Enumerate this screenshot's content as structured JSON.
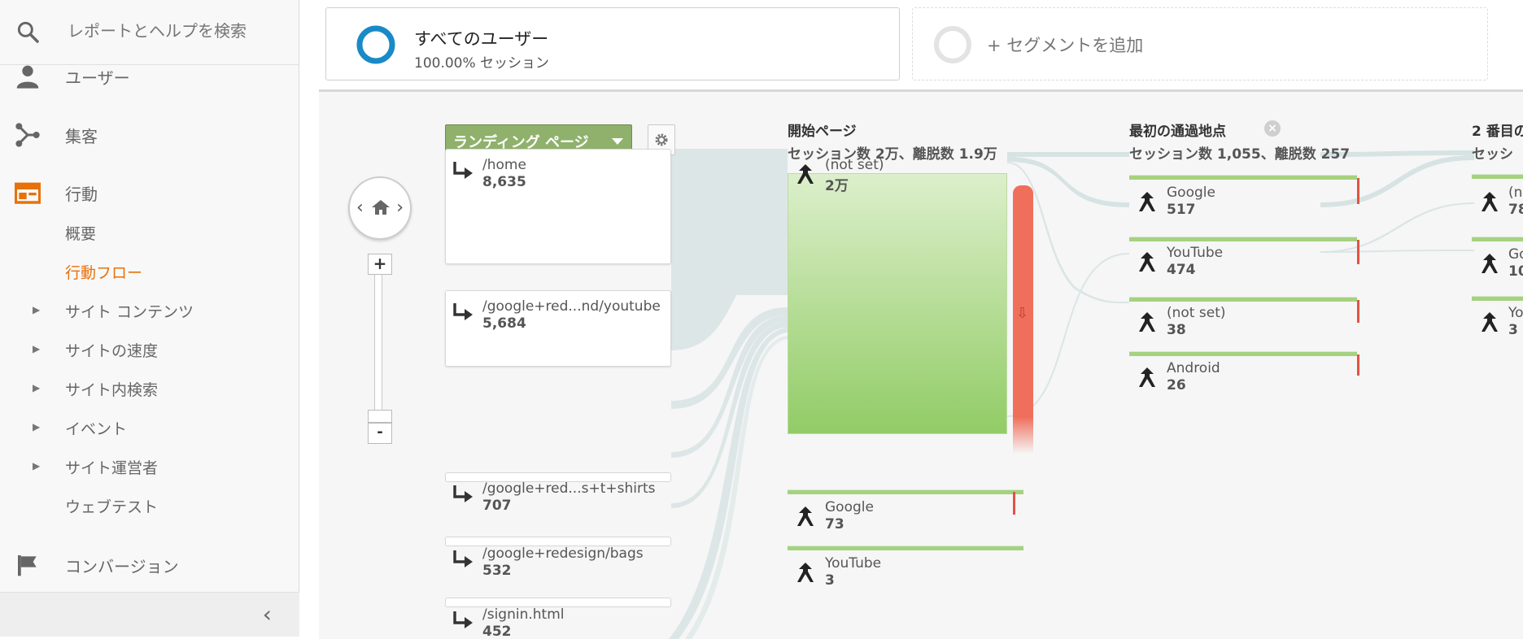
{
  "sidebar": {
    "search_placeholder": "レポートとヘルプを検索",
    "nav": {
      "users": "ユーザー",
      "acquisition": "集客",
      "behavior": "行動",
      "conversion": "コンバージョン"
    },
    "sub_items": [
      {
        "label": "概要",
        "expandable": false,
        "active": false
      },
      {
        "label": "行動フロー",
        "expandable": false,
        "active": true
      },
      {
        "label": "サイト コンテンツ",
        "expandable": true,
        "active": false
      },
      {
        "label": "サイトの速度",
        "expandable": true,
        "active": false
      },
      {
        "label": "サイト内検索",
        "expandable": true,
        "active": false
      },
      {
        "label": "イベント",
        "expandable": true,
        "active": false
      },
      {
        "label": "サイト運営者",
        "expandable": true,
        "active": false
      },
      {
        "label": "ウェブテスト",
        "expandable": false,
        "active": false
      }
    ],
    "collapse_glyph": "‹"
  },
  "segments": {
    "primary_name": "すべてのユーザー",
    "primary_pct": "100.00% セッション",
    "add_label": "+ セグメントを追加"
  },
  "flow": {
    "dimension_dropdown": "ランディング ページ",
    "columns": {
      "start": {
        "title": "開始ページ",
        "stats": "セッション数 2万、離脱数 1.9万"
      },
      "first": {
        "title": "最初の通過地点",
        "stats": "セッション数 1,055、離脱数 257"
      },
      "second": {
        "title": "2 番目の",
        "stats": "セッシ"
      }
    },
    "landing_pages": [
      {
        "path": "/home",
        "value": "8,635"
      },
      {
        "path": "/google+red...nd/youtube",
        "value": "5,684"
      },
      {
        "path": "/google+red...s+t+shirts",
        "value": "707"
      },
      {
        "path": "/google+redesign/bags",
        "value": "532"
      },
      {
        "path": "/signin.html",
        "value": "452"
      }
    ],
    "start_nodes": [
      {
        "label": "(not set)",
        "value": "2万"
      },
      {
        "label": "Google",
        "value": "73"
      },
      {
        "label": "YouTube",
        "value": "3"
      }
    ],
    "first_nodes": [
      {
        "label": "Google",
        "value": "517"
      },
      {
        "label": "YouTube",
        "value": "474"
      },
      {
        "label": "(not set)",
        "value": "38"
      },
      {
        "label": "Android",
        "value": "26"
      }
    ],
    "second_nodes": [
      {
        "label": "(n",
        "value": "78"
      },
      {
        "label": "Go",
        "value": "10"
      },
      {
        "label": "Yo",
        "value": "3"
      }
    ]
  },
  "zoom": {
    "plus": "+",
    "minus": "-"
  },
  "colors": {
    "accent": "#e8710a",
    "dropdown": "#8fb16b",
    "dropoff": "#ef6f5c",
    "node_green": "#92cc66",
    "ring_blue": "#1a8ac6"
  }
}
